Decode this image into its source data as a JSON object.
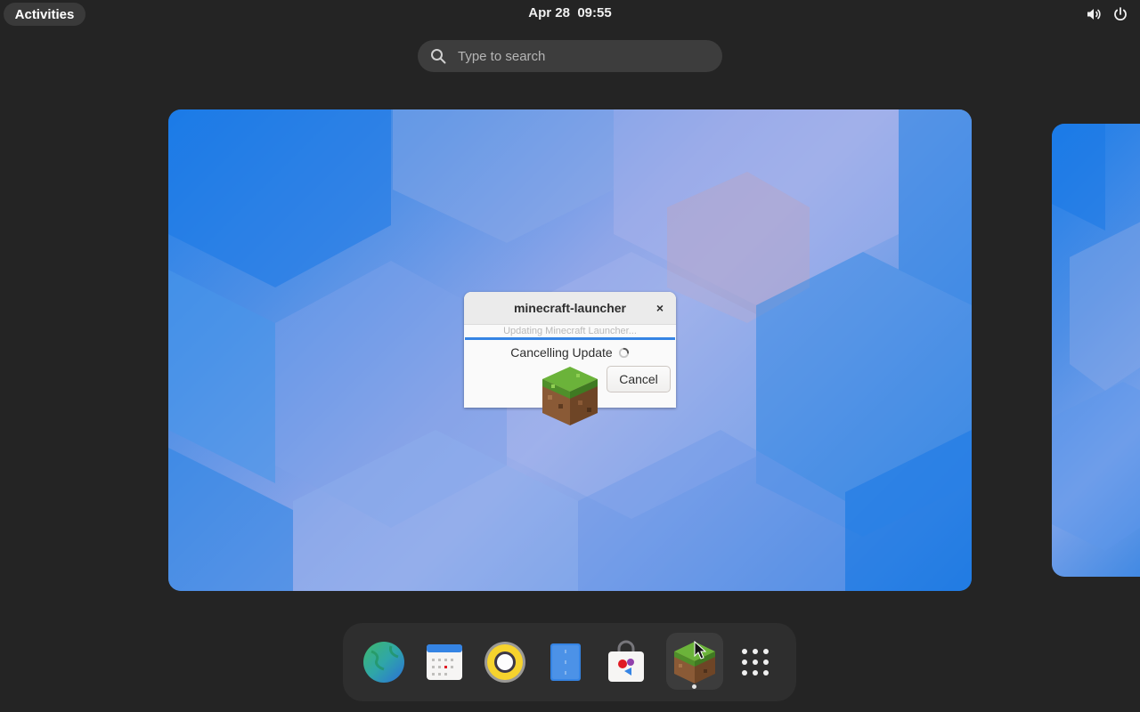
{
  "topbar": {
    "activities_label": "Activities",
    "date": "Apr 28",
    "time": "09:55",
    "tray_icons": [
      "volume-icon",
      "power-icon"
    ]
  },
  "search": {
    "placeholder": "Type to search",
    "value": ""
  },
  "dialog": {
    "title": "minecraft-launcher",
    "subtitle": "Updating Minecraft Launcher...",
    "status": "Cancelling Update",
    "cancel_label": "Cancel",
    "close_symbol": "×",
    "progress_color": "#3584e4"
  },
  "dash": {
    "apps": [
      {
        "name": "web-browser",
        "icon": "globe-icon"
      },
      {
        "name": "calendar",
        "icon": "calendar-icon"
      },
      {
        "name": "music-player",
        "icon": "speaker-icon"
      },
      {
        "name": "text-editor",
        "icon": "notebook-icon"
      },
      {
        "name": "software-store",
        "icon": "shopping-bag-icon"
      },
      {
        "name": "minecraft-launcher",
        "icon": "grass-block-icon",
        "running": true
      },
      {
        "name": "show-apps",
        "icon": "app-grid-icon"
      }
    ]
  },
  "colors": {
    "background": "#242424",
    "accent": "#3584e4",
    "dash_bg": "#2e2e2e"
  }
}
